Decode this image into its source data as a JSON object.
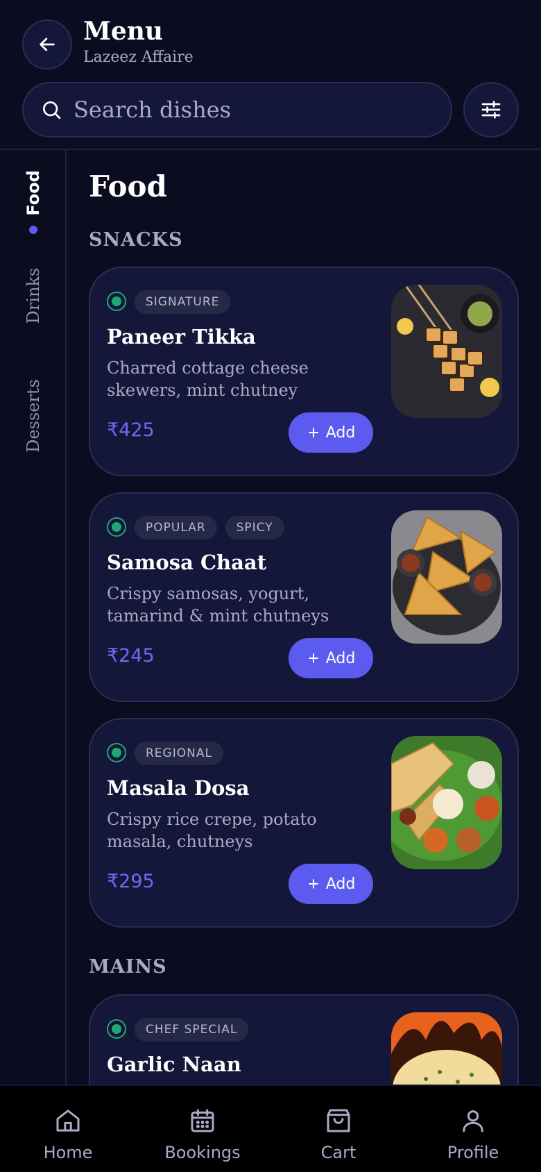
{
  "header": {
    "title": "Menu",
    "subtitle": "Lazeez Affaire"
  },
  "search": {
    "placeholder": "Search dishes",
    "value": ""
  },
  "rail": {
    "items": [
      {
        "label": "Food",
        "active": true
      },
      {
        "label": "Drinks",
        "active": false
      },
      {
        "label": "Desserts",
        "active": false
      }
    ]
  },
  "content": {
    "section_title": "Food",
    "groups": [
      {
        "title": "SNACKS",
        "items": [
          {
            "name": "Paneer Tikka",
            "tags": [
              "SIGNATURE"
            ],
            "description": "Charred cottage cheese skewers, mint chutney",
            "price": "₹425",
            "add_label": "Add"
          },
          {
            "name": "Samosa Chaat",
            "tags": [
              "POPULAR",
              "SPICY"
            ],
            "description": "Crispy samosas, yogurt, tamarind & mint chutneys",
            "price": "₹245",
            "add_label": "Add"
          },
          {
            "name": "Masala Dosa",
            "tags": [
              "REGIONAL"
            ],
            "description": "Crispy rice crepe, potato masala, chutneys",
            "price": "₹295",
            "add_label": "Add"
          }
        ]
      },
      {
        "title": "MAINS",
        "items": [
          {
            "name": "Garlic Naan",
            "tags": [
              "CHEF SPECIAL"
            ]
          }
        ]
      }
    ]
  },
  "bottom_nav": [
    {
      "label": "Home",
      "icon": "home-icon"
    },
    {
      "label": "Bookings",
      "icon": "calendar-icon"
    },
    {
      "label": "Cart",
      "icon": "shopping-bag-icon"
    },
    {
      "label": "Profile",
      "icon": "user-icon"
    }
  ],
  "colors": {
    "background": "#0b0c20",
    "card": "#15173a",
    "accent": "#5b5bf0",
    "veg": "#1fa874"
  }
}
